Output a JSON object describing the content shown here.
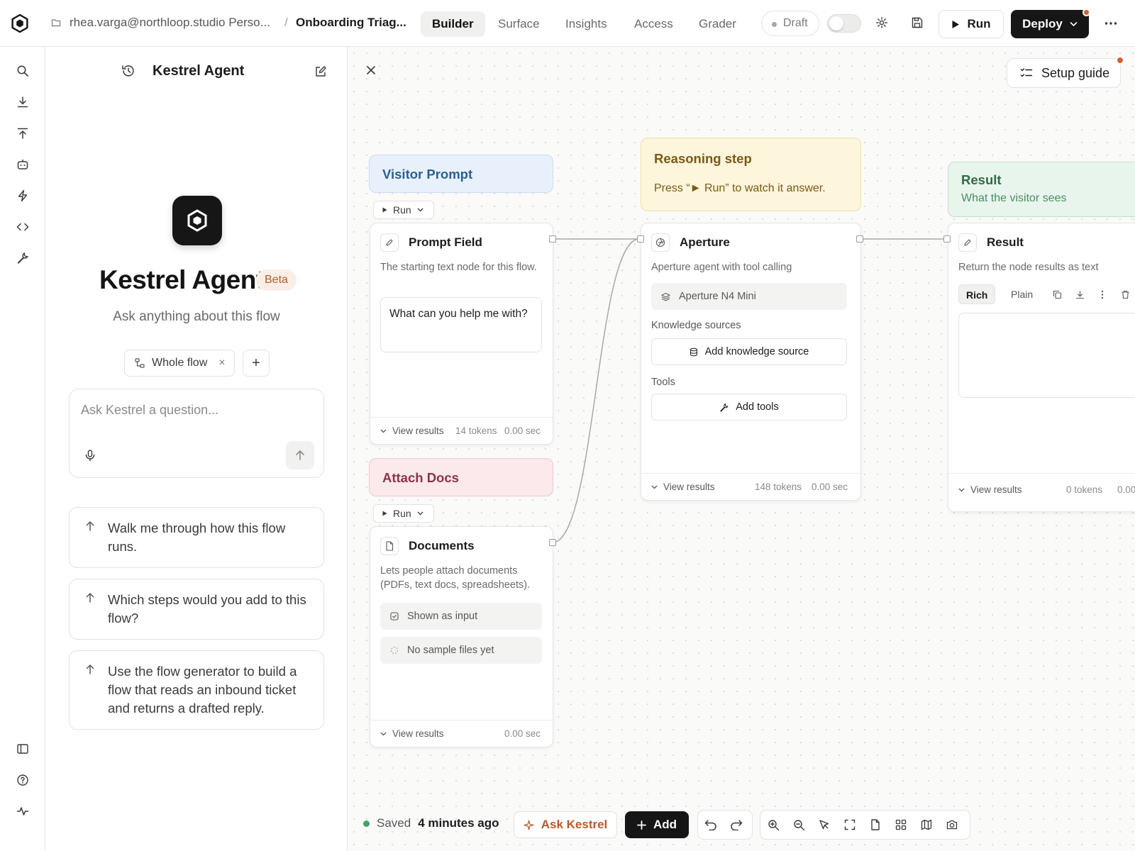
{
  "header": {
    "owner": "rhea.varga@northloop.studio Perso...",
    "separator": "/",
    "flow_name": "Onboarding Triag...",
    "tabs": [
      {
        "label": "Builder",
        "active": true
      },
      {
        "label": "Surface",
        "active": false
      },
      {
        "label": "Insights",
        "active": false
      },
      {
        "label": "Access",
        "active": false
      },
      {
        "label": "Grader",
        "active": false
      }
    ],
    "status": "Draft",
    "run_label": "Run",
    "deploy_label": "Deploy",
    "icons": [
      "logo-icon",
      "folder-icon",
      "gear-icon",
      "save-icon",
      "play-icon",
      "chevron-down-icon",
      "more-icon"
    ]
  },
  "rail": {
    "top_icons": [
      "search-icon",
      "download-icon",
      "upload-icon",
      "bot-icon",
      "lightning-icon",
      "code-icon",
      "wrench-icon"
    ],
    "bottom_icons": [
      "sidebar-icon",
      "help-icon",
      "activity-icon"
    ]
  },
  "assistant": {
    "title": "Kestrel Agent",
    "hero_title": "Kestrel Agent",
    "badge": "Beta",
    "subtitle": "Ask anything about this flow",
    "scope_chip": "Whole flow",
    "scope_remove": "×",
    "scope_add": "+",
    "input_placeholder": "Ask Kestrel a question...",
    "suggestions": [
      "Walk me through how this flow runs.",
      "Which steps would you add to this flow?",
      "Use the flow generator to build a flow that reads an inbound ticket and returns a drafted reply."
    ]
  },
  "canvas": {
    "setup_guide": "Setup guide",
    "groups": {
      "visitor_prompt": {
        "title": "Visitor Prompt",
        "color": "#e8f1fb"
      },
      "reasoning": {
        "title": "Reasoning step",
        "desc": "Press “► Run” to watch it answer.",
        "color": "#fdf5dc"
      },
      "result": {
        "title": "Result",
        "desc": "What the visitor sees",
        "color": "#e8f5ec"
      },
      "attach_docs": {
        "title": "Attach Docs",
        "color": "#fbe9ec"
      }
    },
    "mini_run_label": "Run",
    "nodes": {
      "prompt_field": {
        "title": "Prompt Field",
        "desc": "The starting text node for this flow.",
        "value": "What can you help me with?",
        "view_results": "View results",
        "tokens": "14 tokens",
        "time": "0.00 sec"
      },
      "aperture": {
        "title": "Aperture",
        "desc": "Aperture agent with tool calling",
        "model": "Aperture N4 Mini",
        "knowledge_label": "Knowledge sources",
        "add_knowledge": "Add knowledge source",
        "tools_label": "Tools",
        "add_tools": "Add tools",
        "view_results": "View results",
        "tokens": "148 tokens",
        "time": "0.00 sec"
      },
      "result": {
        "title": "Result",
        "desc": "Return the node results as text",
        "mode_rich": "Rich",
        "mode_plain": "Plain",
        "view_results": "View results",
        "tokens": "0 tokens",
        "time": "0.00"
      },
      "documents": {
        "title": "Documents",
        "desc": "Lets people attach documents (PDFs, text docs, spreadsheets).",
        "shown_as_input": "Shown as input",
        "no_samples": "No sample files yet",
        "view_results": "View results",
        "time": "0.00 sec"
      }
    }
  },
  "footer": {
    "saved_label": "Saved",
    "saved_time": "4 minutes ago",
    "ask_kestrel": "Ask Kestrel",
    "add_label": "Add",
    "tools": [
      "undo-icon",
      "redo-icon",
      "zoom-in-icon",
      "zoom-out-icon",
      "pointer-icon",
      "fit-view-icon",
      "document-icon",
      "grid-icon",
      "map-icon",
      "screenshot-icon"
    ]
  },
  "colors": {
    "accent_orange": "#d4612f",
    "primary_dark": "#161616",
    "saved_green": "#3fa36b"
  }
}
